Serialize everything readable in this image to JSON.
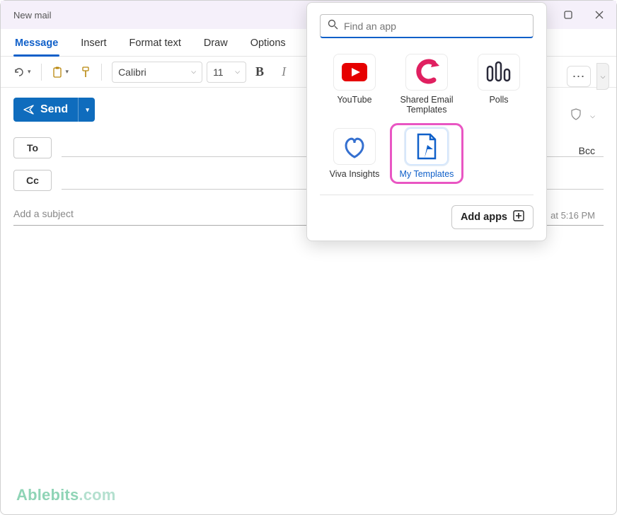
{
  "window": {
    "title": "New mail"
  },
  "tabs": {
    "message": "Message",
    "insert": "Insert",
    "format_text": "Format text",
    "draw": "Draw",
    "options": "Options"
  },
  "toolbar": {
    "font_name": "Calibri",
    "font_size": "11"
  },
  "compose": {
    "send_label": "Send",
    "to_label": "To",
    "cc_label": "Cc",
    "bcc_label": "Bcc",
    "subject_placeholder": "Add a subject",
    "draft_saved": "at 5:16 PM"
  },
  "apps_popup": {
    "search_placeholder": "Find an app",
    "apps": [
      {
        "label": "YouTube"
      },
      {
        "label": "Shared Email Templates"
      },
      {
        "label": "Polls"
      },
      {
        "label": "Viva Insights"
      },
      {
        "label": "My Templates"
      }
    ],
    "add_apps_label": "Add apps"
  },
  "watermark": {
    "brand": "Ablebits",
    "tld": ".com"
  }
}
